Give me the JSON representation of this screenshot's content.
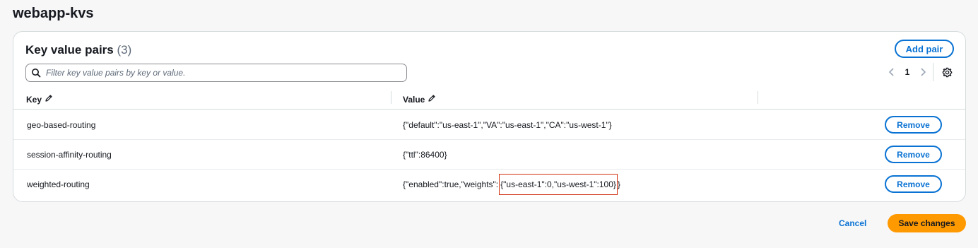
{
  "page": {
    "title": "webapp-kvs"
  },
  "panel": {
    "heading": "Key value pairs",
    "count": "(3)",
    "add_pair_label": "Add pair",
    "search": {
      "placeholder": "Filter key value pairs by key or value.",
      "value": ""
    },
    "pagination": {
      "current_page": "1"
    },
    "columns": {
      "key": "Key",
      "value": "Value"
    },
    "rows": [
      {
        "key": "geo-based-routing",
        "value": "{\"default\":\"us-east-1\",\"VA\":\"us-east-1\",\"CA\":\"us-west-1\"}",
        "remove_label": "Remove"
      },
      {
        "key": "session-affinity-routing",
        "value": "{\"ttl\":86400}",
        "remove_label": "Remove"
      },
      {
        "key": "weighted-routing",
        "value_prefix": "{\"enabled\":true,\"weights\":",
        "value_highlight": "{\"us-east-1\":0,\"us-west-1\":100}",
        "value_suffix": "}",
        "remove_label": "Remove"
      }
    ]
  },
  "footer": {
    "cancel_label": "Cancel",
    "save_label": "Save changes"
  },
  "colors": {
    "accent": "#0972d3",
    "primary_button": "#ff9900",
    "highlight_border": "#d13212"
  },
  "icons": {
    "search": "search-icon",
    "edit": "pencil-icon",
    "prev": "chevron-left-icon",
    "next": "chevron-right-icon",
    "settings": "gear-icon"
  }
}
